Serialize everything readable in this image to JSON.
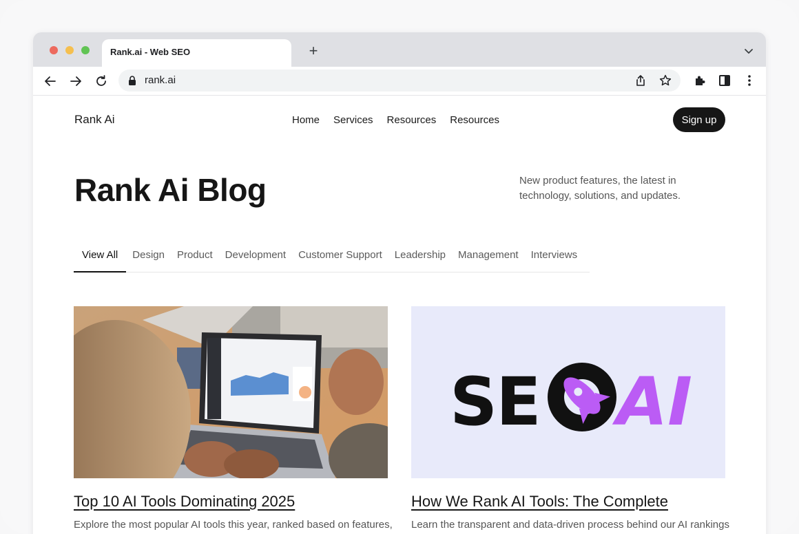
{
  "browser": {
    "tab_title": "Rank.ai - Web SEO",
    "url": "rank.ai"
  },
  "site": {
    "logo": "Rank Ai",
    "nav": [
      "Home",
      "Services",
      "Resources",
      "Resources"
    ],
    "signup_label": "Sign up"
  },
  "hero": {
    "title": "Rank Ai Blog",
    "subtitle": "New product features, the latest in technology, solutions, and updates."
  },
  "filters": [
    "View All",
    "Design",
    "Product",
    "Development",
    "Customer Support",
    "Leadership",
    "Management",
    "Interviews"
  ],
  "active_filter": "View All",
  "posts": [
    {
      "title": "Top 10 AI Tools Dominating 2025",
      "excerpt": "Explore the most popular AI tools this year, ranked based on features,"
    },
    {
      "title": "How We Rank AI Tools: The Complete",
      "excerpt": "Learn the transparent and data-driven process behind our AI rankings",
      "image_logo_text": "SEO AI"
    }
  ],
  "colors": {
    "accent_purple": "#bb5cf5",
    "button_dark": "#161616",
    "seo_card_bg": "#e8eafa"
  }
}
